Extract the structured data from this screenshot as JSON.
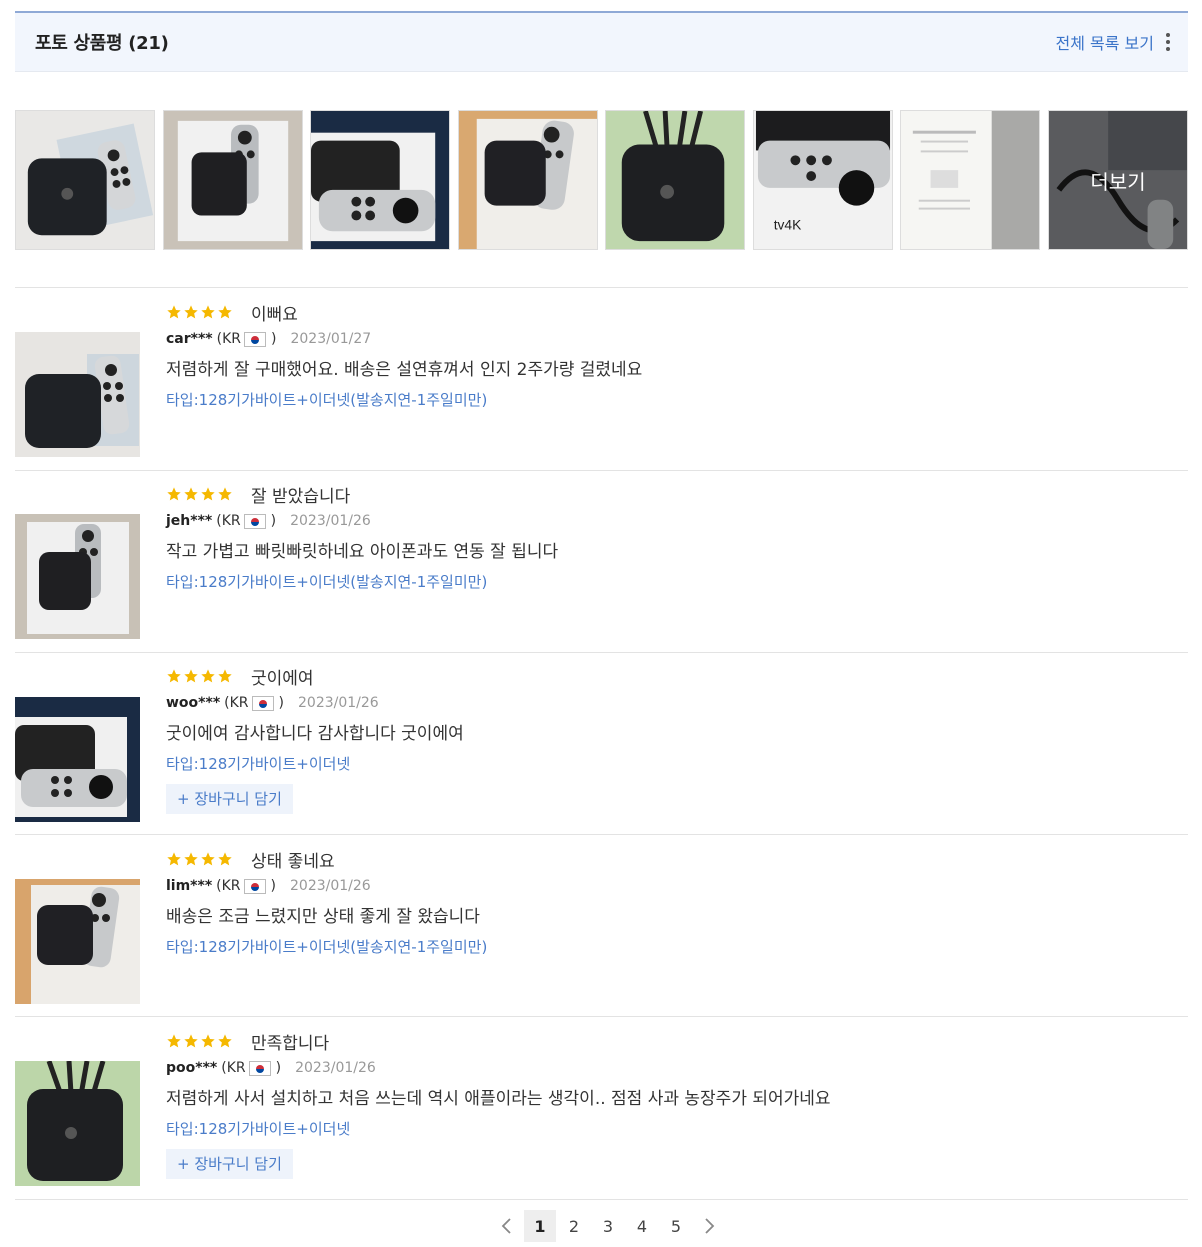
{
  "header": {
    "title": "포토 상품평 (21)",
    "view_all_label": "전체 목록 보기"
  },
  "gallery": {
    "more_label": "더보기",
    "items": [
      {
        "icon": "apple-tv-box-and-remote"
      },
      {
        "icon": "apple-tv-package"
      },
      {
        "icon": "apple-tv-package-remote"
      },
      {
        "icon": "apple-tv-package-open"
      },
      {
        "icon": "apple-tv-box-cables"
      },
      {
        "icon": "apple-tv-4k-box"
      },
      {
        "icon": "documents-pack"
      },
      {
        "icon": "remote-cables"
      }
    ]
  },
  "reviews": [
    {
      "rating": 4,
      "headline": "이뻐요",
      "user": "car***",
      "country": "KR",
      "date": "2023/01/27",
      "content": "저렴하게 잘 구매했어요. 배송은 설연휴껴서 인지 2주가량 걸렸네요",
      "option": "타입:128기가바이트+이더넷(발송지연-1주일미만)",
      "cart": ""
    },
    {
      "rating": 4,
      "headline": "잘 받았습니다",
      "user": "jeh***",
      "country": "KR",
      "date": "2023/01/26",
      "content": "작고 가볍고 빠릿빠릿하네요 아이폰과도 연동 잘 됩니다",
      "option": "타입:128기가바이트+이더넷(발송지연-1주일미만)",
      "cart": ""
    },
    {
      "rating": 4,
      "headline": "굿이에여",
      "user": "woo***",
      "country": "KR",
      "date": "2023/01/26",
      "content": "굿이에여 감사합니다 감사합니다 굿이에여",
      "option": "타입:128기가바이트+이더넷",
      "cart": "+ 장바구니 담기"
    },
    {
      "rating": 4,
      "headline": "상태 좋네요",
      "user": "lim***",
      "country": "KR",
      "date": "2023/01/26",
      "content": "배송은 조금 느렸지만 상태 좋게 잘 왔습니다",
      "option": "타입:128기가바이트+이더넷(발송지연-1주일미만)",
      "cart": ""
    },
    {
      "rating": 4,
      "headline": "만족합니다",
      "user": "poo***",
      "country": "KR",
      "date": "2023/01/26",
      "content": "저렴하게 사서 설치하고 처음 쓰는데 역시 애플이라는 생각이.. 점점 사과 농장주가 되어가네요",
      "option": "타입:128기가바이트+이더넷",
      "cart": "+ 장바구니 담기"
    }
  ],
  "pagination": {
    "pages": [
      "1",
      "2",
      "3",
      "4",
      "5"
    ],
    "current": "1"
  },
  "colors": {
    "accent": "#3b74c9",
    "star": "#f5b800",
    "header_bg": "#f2f6fd"
  }
}
